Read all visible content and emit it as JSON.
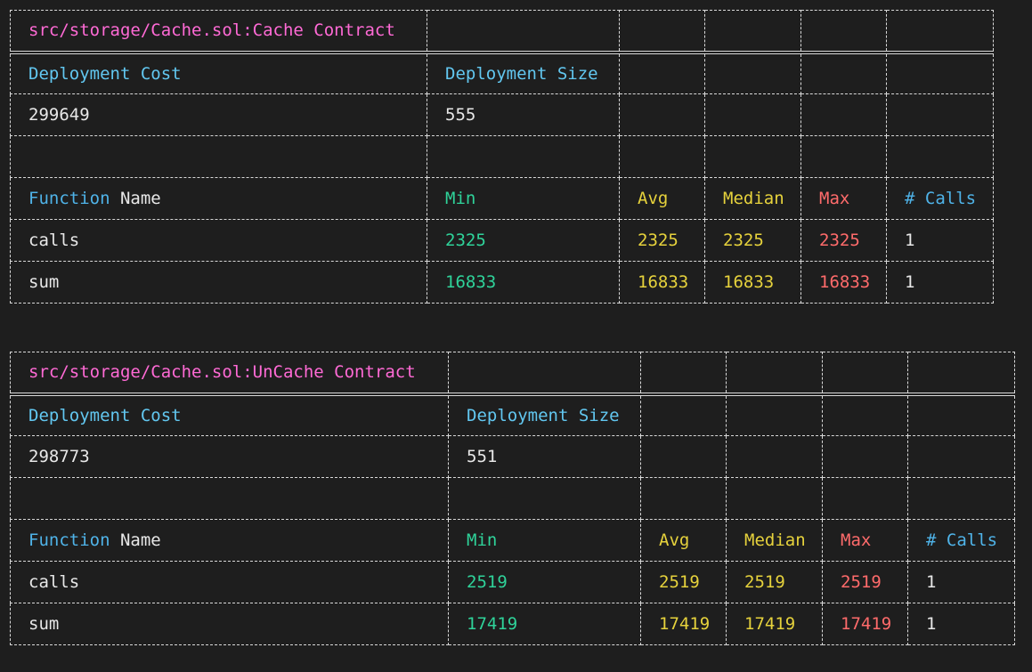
{
  "tables": [
    {
      "title": "src/storage/Cache.sol:Cache Contract",
      "deployment_cost_label": "Deployment Cost",
      "deployment_size_label": "Deployment Size",
      "deployment_cost": "299649",
      "deployment_size": "555",
      "function_label": "Function",
      "name_label": "Name",
      "min_label": "Min",
      "avg_label": "Avg",
      "median_label": "Median",
      "max_label": "Max",
      "calls_label": "# Calls",
      "rows": [
        {
          "name": "calls",
          "min": "2325",
          "avg": "2325",
          "median": "2325",
          "max": "2325",
          "calls": "1"
        },
        {
          "name": "sum",
          "min": "16833",
          "avg": "16833",
          "median": "16833",
          "max": "16833",
          "calls": "1"
        }
      ]
    },
    {
      "title": "src/storage/Cache.sol:UnCache Contract",
      "deployment_cost_label": "Deployment Cost",
      "deployment_size_label": "Deployment Size",
      "deployment_cost": "298773",
      "deployment_size": "551",
      "function_label": "Function",
      "name_label": "Name",
      "min_label": "Min",
      "avg_label": "Avg",
      "median_label": "Median",
      "max_label": "Max",
      "calls_label": "# Calls",
      "rows": [
        {
          "name": "calls",
          "min": "2519",
          "avg": "2519",
          "median": "2519",
          "max": "2519",
          "calls": "1"
        },
        {
          "name": "sum",
          "min": "17419",
          "avg": "17419",
          "median": "17419",
          "max": "17419",
          "calls": "1"
        }
      ]
    }
  ],
  "colors": {
    "background": "#1e1e1e",
    "title": "#ff6ad5",
    "header": "#62c7f0",
    "min": "#2fd39a",
    "avg_median": "#e6d23c",
    "max": "#ff6b6b"
  }
}
